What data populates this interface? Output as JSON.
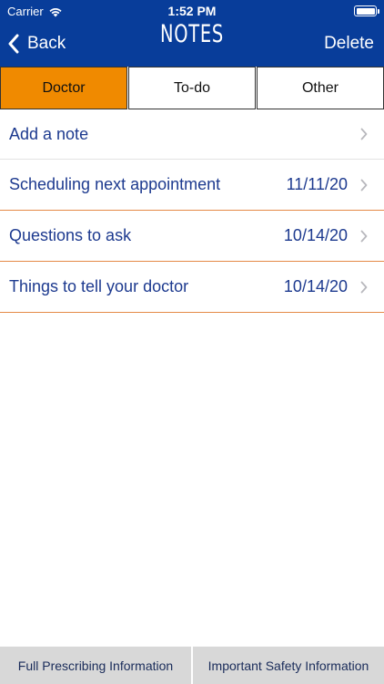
{
  "status_bar": {
    "carrier": "Carrier",
    "time": "1:52 PM"
  },
  "nav": {
    "back_label": "Back",
    "title": "NOTES",
    "delete_label": "Delete"
  },
  "tabs": [
    {
      "label": "Doctor",
      "active": true
    },
    {
      "label": "To-do",
      "active": false
    },
    {
      "label": "Other",
      "active": false
    }
  ],
  "notes": {
    "add_label": "Add a note",
    "items": [
      {
        "title": "Scheduling next appointment",
        "date": "11/11/20"
      },
      {
        "title": "Questions to ask",
        "date": "10/14/20"
      },
      {
        "title": "Things to tell your doctor",
        "date": "10/14/20"
      }
    ]
  },
  "footer": {
    "prescribing_label": "Full Prescribing Information",
    "safety_label": "Important Safety Information"
  },
  "colors": {
    "header": "#083d9a",
    "accent_tab": "#f08a00",
    "row_text": "#1d3a8f",
    "divider": "#e58a47",
    "footer_bg": "#d8d8d8"
  },
  "icons": [
    "wifi-icon",
    "battery-icon",
    "back-chevron-icon",
    "chevron-right-icon"
  ]
}
